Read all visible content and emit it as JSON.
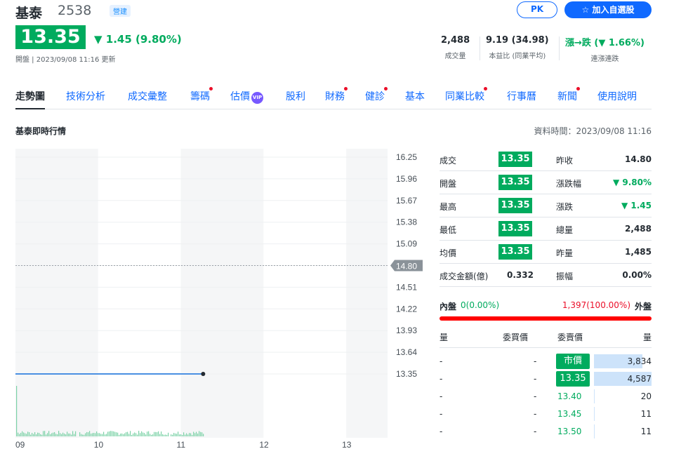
{
  "header": {
    "name": "基泰",
    "code": "2538",
    "tag": "營建",
    "pk_label": "PK",
    "add_label": "☆ 加入自選股",
    "price": "13.35",
    "change": "▼ 1.45 (9.80%)",
    "meta": "開盤 | 2023/09/08 11:16 更新"
  },
  "key_stats": [
    {
      "value": "2,488",
      "label": "成交量"
    },
    {
      "value": "9.19 (34.98)",
      "label": "本益比 (同業平均)"
    },
    {
      "value": "漲→跌 (▼ 1.66%)",
      "label": "連漲連跌"
    }
  ],
  "tabs": [
    {
      "label": "走勢圖",
      "active": true,
      "dot": false
    },
    {
      "label": "技術分析",
      "dot": false
    },
    {
      "label": "成交彙整",
      "dot": false
    },
    {
      "label": "籌碼",
      "dot": true
    },
    {
      "label": "估價",
      "dot": false,
      "vip": "VIP"
    },
    {
      "label": "股利",
      "dot": false
    },
    {
      "label": "財務",
      "dot": true
    },
    {
      "label": "健診",
      "dot": true
    },
    {
      "label": "基本",
      "dot": false
    },
    {
      "label": "同業比較",
      "dot": true
    },
    {
      "label": "行事曆",
      "dot": false
    },
    {
      "label": "新聞",
      "dot": true
    },
    {
      "label": "使用說明",
      "dot": false
    }
  ],
  "section": {
    "title": "基泰即時行情",
    "data_time": "資料時間：2023/09/08 11:16"
  },
  "chart_data": {
    "type": "line",
    "x_ticks": [
      "09",
      "10",
      "11",
      "12",
      "13"
    ],
    "y_ticks": [
      "16.25",
      "15.96",
      "15.67",
      "15.38",
      "15.09",
      "14.80",
      "14.51",
      "14.22",
      "13.93",
      "13.64",
      "13.35"
    ],
    "ylim": [
      13.35,
      16.25
    ],
    "reference": {
      "value": 14.8,
      "label": "14.80"
    },
    "series": [
      {
        "values": [
          13.35,
          13.35
        ],
        "x_hours": [
          9.0,
          11.27
        ]
      }
    ],
    "volume_hint": "dense daily volume bars from 09:00 to ~11:16"
  },
  "quote": [
    {
      "label": "成交",
      "value": "13.35",
      "label2": "昨收",
      "value2": "14.80",
      "down2": false
    },
    {
      "label": "開盤",
      "value": "13.35",
      "label2": "漲跌幅",
      "value2": "▼ 9.80%",
      "down2": true
    },
    {
      "label": "最高",
      "value": "13.35",
      "label2": "漲跌",
      "value2": "▼ 1.45",
      "down2": true
    },
    {
      "label": "最低",
      "value": "13.35",
      "label2": "總量",
      "value2": "2,488",
      "down2": false
    },
    {
      "label": "均價",
      "value": "13.35",
      "label2": "昨量",
      "value2": "1,485",
      "down2": false
    },
    {
      "label": "成交金額(億)",
      "value": "0.332",
      "label2": "振幅",
      "value2": "0.00%",
      "down2": false,
      "plain": true
    }
  ],
  "inout": {
    "in_label": "內盤",
    "in_value": "0(0.00%)",
    "out_value": "1,397(100.00%)",
    "out_label": "外盤",
    "in_fraction": 0.0
  },
  "orderbook": {
    "headers": [
      "量",
      "委買價",
      "委賣價",
      "量"
    ],
    "rows": [
      {
        "bid_vol": "-",
        "bid_px": "-",
        "ask_px": "市價",
        "ask_vol": "3,834",
        "box": true,
        "bar": 0.84
      },
      {
        "bid_vol": "-",
        "bid_px": "-",
        "ask_px": "13.35",
        "ask_vol": "4,587",
        "box": true,
        "bar": 1.0
      },
      {
        "bid_vol": "-",
        "bid_px": "-",
        "ask_px": "13.40",
        "ask_vol": "20",
        "box": false,
        "bar": 0.0
      },
      {
        "bid_vol": "-",
        "bid_px": "-",
        "ask_px": "13.45",
        "ask_vol": "11",
        "box": false,
        "bar": 0.0
      },
      {
        "bid_vol": "-",
        "bid_px": "-",
        "ask_px": "13.50",
        "ask_vol": "11",
        "box": false,
        "bar": 0.0
      }
    ]
  },
  "colors": {
    "down": "#00ab5e",
    "up": "#eb0f29",
    "accent": "#0f69ff",
    "line": "#4a90e2"
  }
}
